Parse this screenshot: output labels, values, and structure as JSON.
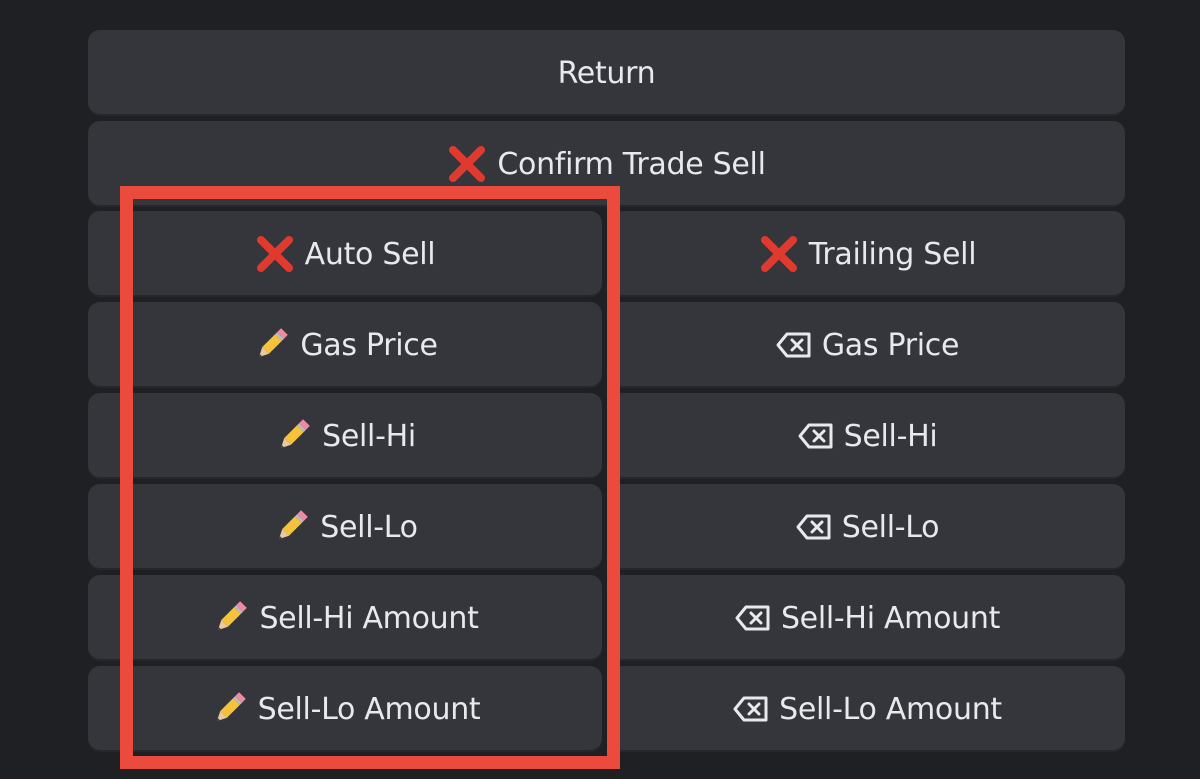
{
  "colors": {
    "background": "#1e2024",
    "button": "#34363b",
    "button_text": "#e8e9ec",
    "highlight_border": "#ea4b3c",
    "cross_icon": "#e03a2f",
    "pencil_body": "#f5c23b"
  },
  "keyboard": {
    "return_label": "Return",
    "confirm_trade_sell_label": "Confirm Trade Sell",
    "auto_sell_label": "Auto Sell",
    "trailing_sell_label": "Trailing Sell",
    "edit_gas_price_label": "Gas Price",
    "clear_gas_price_label": "Gas Price",
    "edit_sell_hi_label": "Sell-Hi",
    "clear_sell_hi_label": "Sell-Hi",
    "edit_sell_lo_label": "Sell-Lo",
    "clear_sell_lo_label": "Sell-Lo",
    "edit_sell_hi_amount_label": "Sell-Hi Amount",
    "clear_sell_hi_amount_label": "Sell-Hi Amount",
    "edit_sell_lo_amount_label": "Sell-Lo Amount",
    "clear_sell_lo_amount_label": "Sell-Lo Amount"
  },
  "icons": {
    "cross": "cross-mark-icon",
    "pencil": "pencil-icon",
    "erase": "erase-left-icon"
  }
}
